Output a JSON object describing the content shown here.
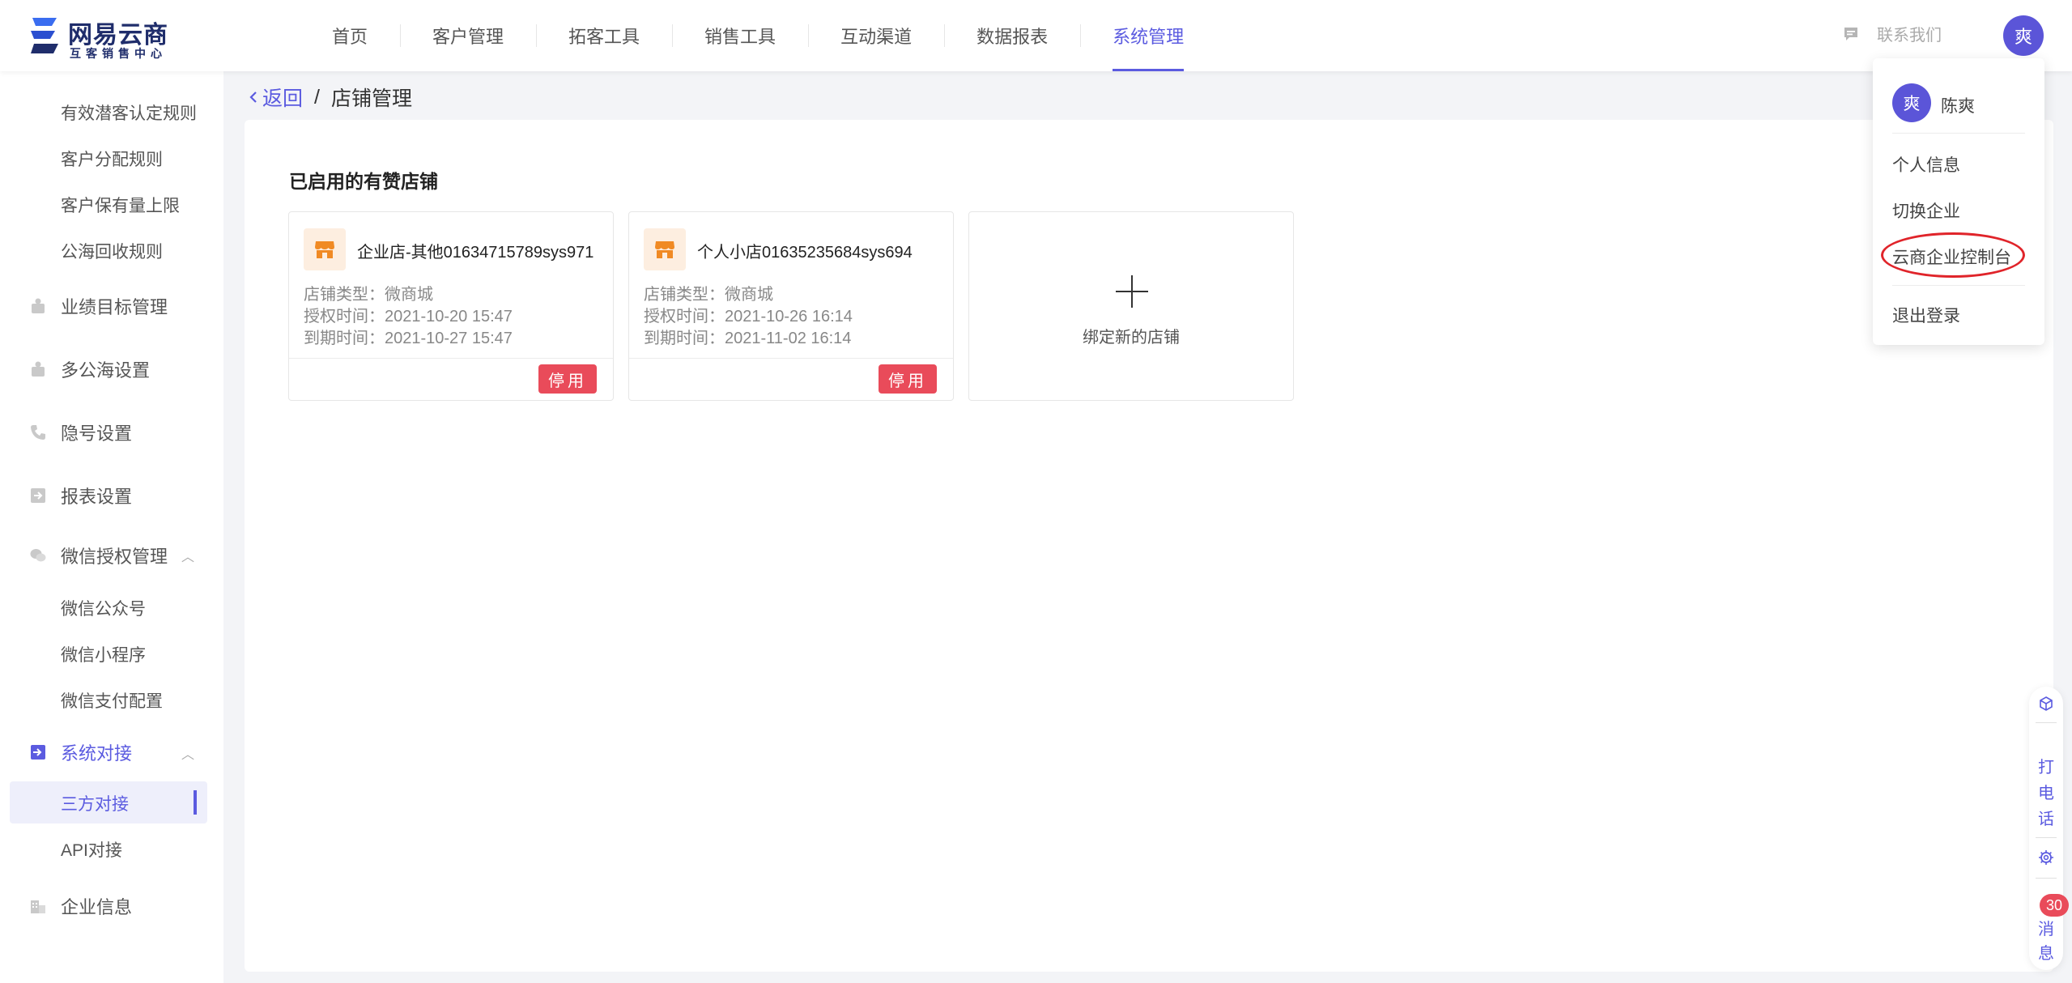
{
  "brand": {
    "name": "网易云商",
    "subtitle": "互客销售中心"
  },
  "nav": {
    "items": [
      "首页",
      "客户管理",
      "拓客工具",
      "销售工具",
      "互动渠道",
      "数据报表",
      "系统管理"
    ],
    "active": "系统管理",
    "contact_label": "联系我们",
    "avatar_text": "爽"
  },
  "sidebar": {
    "sub_top": [
      "有效潜客认定规则",
      "客户分配规则",
      "客户保有量上限",
      "公海回收规则"
    ],
    "groups": {
      "performance": "业绩目标管理",
      "multi_sea": "多公海设置",
      "hidden_number": "隐号设置",
      "report": "报表设置",
      "wechat": "微信授权管理",
      "system_integration": "系统对接",
      "enterprise_info": "企业信息"
    },
    "wechat_children": [
      "微信公众号",
      "微信小程序",
      "微信支付配置"
    ],
    "integration_children": [
      "三方对接",
      "API对接"
    ],
    "active_item": "三方对接"
  },
  "breadcrumb": {
    "back": "返回",
    "separator": "/",
    "current": "店铺管理"
  },
  "main": {
    "section_title": "已启用的有赞店铺",
    "shops": [
      {
        "name": "企业店-其他01634715789sys971",
        "type": "店铺类型：微商城",
        "auth_time": "授权时间：2021-10-20 15:47",
        "expire_time": "到期时间：2021-10-27 15:47",
        "action": "停用"
      },
      {
        "name": "个人小店01635235684sys694",
        "type": "店铺类型：微商城",
        "auth_time": "授权时间：2021-10-26 16:14",
        "expire_time": "到期时间：2021-11-02 16:14",
        "action": "停用"
      }
    ],
    "add_shop_label": "绑定新的店铺"
  },
  "user_menu": {
    "avatar_text": "爽",
    "user_name": "陈爽",
    "items": [
      "个人信息",
      "切换企业",
      "云商企业控制台",
      "退出登录"
    ]
  },
  "float_toolbar": {
    "call_label": [
      "打",
      "电",
      "话"
    ],
    "message_label": [
      "消",
      "息"
    ],
    "message_count": "30"
  },
  "colors": {
    "accent": "#5b5be0",
    "danger": "#e94b5a",
    "shop_icon": "#f08a24"
  }
}
